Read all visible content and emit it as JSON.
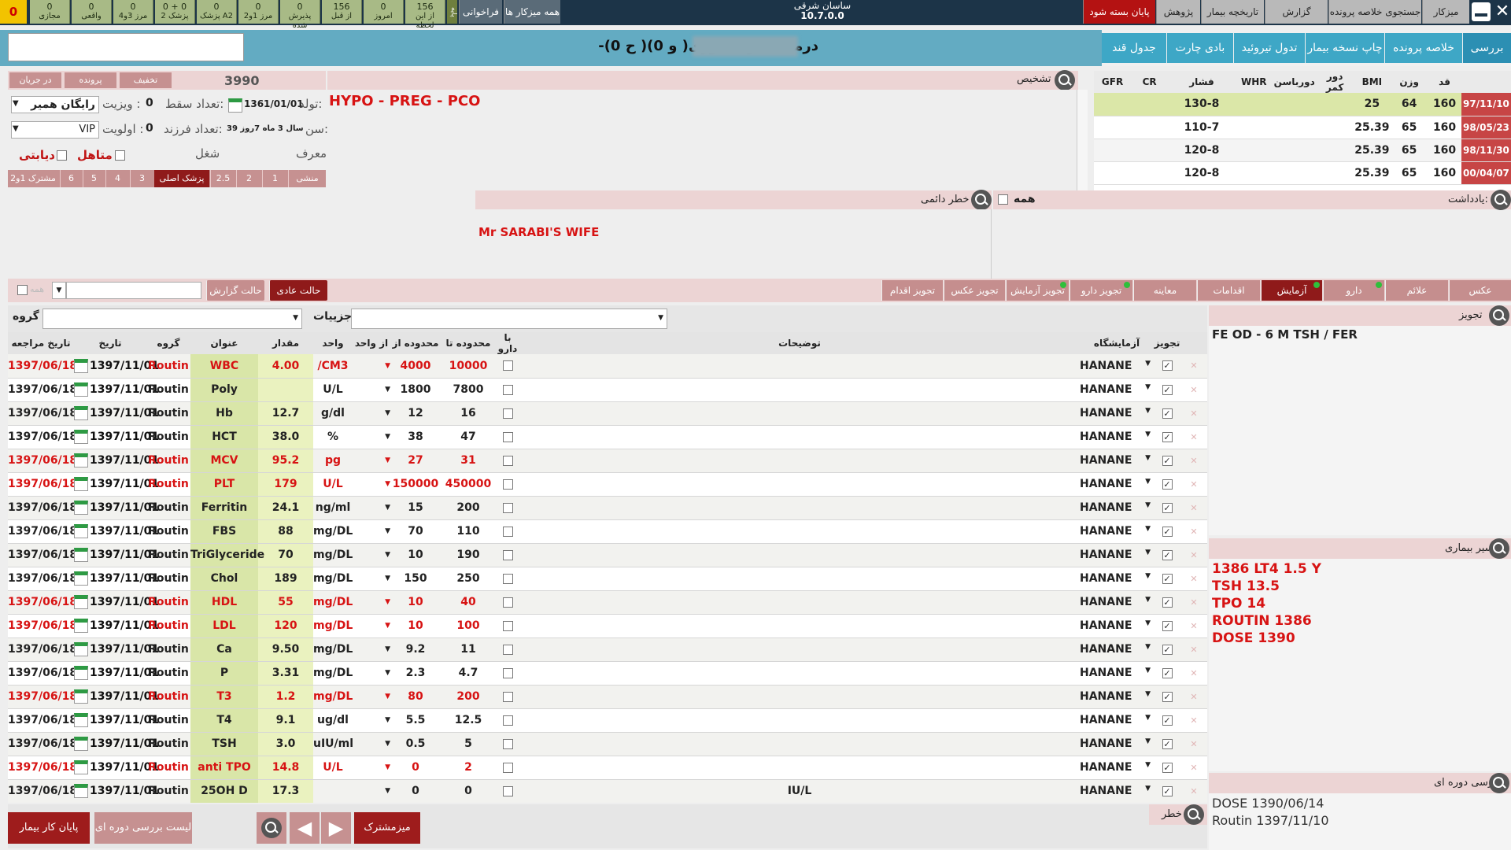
{
  "topbar": {
    "alert_count": "0",
    "stats": [
      {
        "value": "0",
        "label": "مجازی"
      },
      {
        "value": "0",
        "label": "واقعی"
      },
      {
        "value": "0",
        "label": "مرز 3و4"
      },
      {
        "value": "0 + 0",
        "label": "پزشک 2"
      },
      {
        "value": "0",
        "label": "پزشک A2"
      },
      {
        "value": "0",
        "label": "مرز 1و2"
      },
      {
        "value": "0",
        "label": "پذیرش شده"
      },
      {
        "value": "156",
        "label": "از قبل"
      },
      {
        "value": "0",
        "label": "امروز"
      },
      {
        "value": "156",
        "label": "از این لحظه"
      }
    ],
    "side_label_paye": "پایه",
    "btn_farakhani": "فراخوانی",
    "btn_all_mizkar": "همه میزکار ها",
    "center_title": "ساسان شرقی",
    "version": "10.7.0.0",
    "btn_end": "پایان بسته شود",
    "menu": [
      "پژوهش",
      "تاریخچه بیمار",
      "گزارش پرداختی",
      "جستجوی خلاصه پرونده",
      "میزکار"
    ]
  },
  "nav": {
    "patient_title": "-درمان غیر حضوری( و 0)( ح 0)",
    "tabs": [
      "جدول قند",
      "بادی چارت",
      "تدول تیروئید",
      "چاپ نسخه بیمار",
      "خلاصه پرونده",
      "بررسی"
    ]
  },
  "patient": {
    "amount": "3990",
    "btn_takhfif": "تخفیف",
    "btn_parvande": "پرونده",
    "btn_dar_jaryan": "در جریان",
    "birth_label": "تولد:",
    "birth": "1361/01/01",
    "age_label": "سن:",
    "age": "39 سال 3 ماه 7روز",
    "visit_label": "ویزیت :",
    "visit": "رایگان همیر",
    "priority_label": "اولویت :",
    "priority": "VIP",
    "abortion_label": "تعداد سقط:",
    "abortion": "0",
    "children_label": "تعداد فرزند:",
    "children": "0",
    "job_label": "شغل",
    "moaref_label": "معرف",
    "married_label": "متاهل",
    "diabetic_label": "دیابتی",
    "doc_tabs": [
      "منشی",
      "1",
      "2",
      "2.5",
      "پزشک اصلی",
      "3",
      "4",
      "5",
      "6",
      "مشترک 1و2"
    ],
    "diagnosis_label": "تشخیص",
    "diagnosis": "HYPO - PREG - PCO"
  },
  "vitals": {
    "headers": [
      "قد",
      "وزن",
      "BMI",
      "دور کمر",
      "دورباسن",
      "WHR",
      "فشار",
      "CR",
      "GFR"
    ],
    "rows": [
      {
        "date": "97/11/10",
        "height": "160",
        "weight": "64",
        "bmi": "25",
        "bp": "130-8"
      },
      {
        "date": "98/05/23",
        "height": "160",
        "weight": "65",
        "bmi": "25.39",
        "bp": "110-7"
      },
      {
        "date": "98/11/30",
        "height": "160",
        "weight": "65",
        "bmi": "25.39",
        "bp": "120-8"
      },
      {
        "date": "00/04/07",
        "height": "160",
        "weight": "65",
        "bmi": "25.39",
        "bp": "120-8"
      }
    ]
  },
  "notes": {
    "yaddasht_label": "یادداشت:",
    "all_label": "همه",
    "permanent_risk_label": "خطر دائمی",
    "permanent_risk": "Mr  SARABI'S  WIFE"
  },
  "tabs2": {
    "items": [
      "عکس",
      "علائم",
      "دارو",
      "آزمایش",
      "اقدامات",
      "معاینه",
      "تجویز دارو",
      "تجویز آزمایش",
      "تجویز عکس",
      "تجویز اقدام"
    ],
    "active": "آزمایش",
    "mode_normal": "حالت عادی",
    "mode_report": "حالت گزارش",
    "all_small": "همه"
  },
  "filters": {
    "group_label": "گروه",
    "details_label": "جزییات"
  },
  "lab": {
    "headers": [
      "تجویز",
      "آزمایشگاه",
      "توضیحات",
      "با دارو",
      "محدوده تا",
      "محدوده از",
      "از واحد",
      "واحد",
      "مقدار",
      "عنوان",
      "گروه",
      "تاریخ",
      "تاریخ مراجعه"
    ],
    "rows": [
      {
        "ref": "1397/06/18",
        "date": "1397/11/01",
        "group": "Routin",
        "title": "WBC",
        "value": "4.00",
        "unit": "/CM3",
        "from": "4000",
        "to": "10000",
        "desc": "",
        "lab": "HANANE",
        "red": true
      },
      {
        "ref": "1397/06/18",
        "date": "1397/11/01",
        "group": "Routin",
        "title": "Poly",
        "value": "",
        "unit": "U/L",
        "from": "1800",
        "to": "7800",
        "desc": "",
        "lab": "HANANE",
        "red": false
      },
      {
        "ref": "1397/06/18",
        "date": "1397/11/01",
        "group": "Routin",
        "title": "Hb",
        "value": "12.7",
        "unit": "g/dl",
        "from": "12",
        "to": "16",
        "desc": "",
        "lab": "HANANE",
        "red": false
      },
      {
        "ref": "1397/06/18",
        "date": "1397/11/01",
        "group": "Routin",
        "title": "HCT",
        "value": "38.0",
        "unit": "%",
        "from": "38",
        "to": "47",
        "desc": "",
        "lab": "HANANE",
        "red": false
      },
      {
        "ref": "1397/06/18",
        "date": "1397/11/01",
        "group": "Routin",
        "title": "MCV",
        "value": "95.2",
        "unit": "pg",
        "from": "27",
        "to": "31",
        "desc": "",
        "lab": "HANANE",
        "red": true
      },
      {
        "ref": "1397/06/18",
        "date": "1397/11/01",
        "group": "Routin",
        "title": "PLT",
        "value": "179",
        "unit": "U/L",
        "from": "150000",
        "to": "450000",
        "desc": "",
        "lab": "HANANE",
        "red": true
      },
      {
        "ref": "1397/06/18",
        "date": "1397/11/01",
        "group": "Routin",
        "title": "Ferritin",
        "value": "24.1",
        "unit": "ng/ml",
        "from": "15",
        "to": "200",
        "desc": "",
        "lab": "HANANE",
        "red": false
      },
      {
        "ref": "1397/06/18",
        "date": "1397/11/01",
        "group": "Routin",
        "title": "FBS",
        "value": "88",
        "unit": "mg/DL",
        "from": "70",
        "to": "110",
        "desc": "",
        "lab": "HANANE",
        "red": false
      },
      {
        "ref": "1397/06/18",
        "date": "1397/11/01",
        "group": "Routin",
        "title": "TriGlyceride",
        "value": "70",
        "unit": "mg/DL",
        "from": "10",
        "to": "190",
        "desc": "",
        "lab": "HANANE",
        "red": false
      },
      {
        "ref": "1397/06/18",
        "date": "1397/11/01",
        "group": "Routin",
        "title": "Chol",
        "value": "189",
        "unit": "mg/DL",
        "from": "150",
        "to": "250",
        "desc": "",
        "lab": "HANANE",
        "red": false
      },
      {
        "ref": "1397/06/18",
        "date": "1397/11/01",
        "group": "Routin",
        "title": "HDL",
        "value": "55",
        "unit": "mg/DL",
        "from": "10",
        "to": "40",
        "desc": "",
        "lab": "HANANE",
        "red": true
      },
      {
        "ref": "1397/06/18",
        "date": "1397/11/01",
        "group": "Routin",
        "title": "LDL",
        "value": "120",
        "unit": "mg/DL",
        "from": "10",
        "to": "100",
        "desc": "",
        "lab": "HANANE",
        "red": true
      },
      {
        "ref": "1397/06/18",
        "date": "1397/11/01",
        "group": "Routin",
        "title": "Ca",
        "value": "9.50",
        "unit": "mg/DL",
        "from": "9.2",
        "to": "11",
        "desc": "",
        "lab": "HANANE",
        "red": false
      },
      {
        "ref": "1397/06/18",
        "date": "1397/11/01",
        "group": "Routin",
        "title": "P",
        "value": "3.31",
        "unit": "mg/DL",
        "from": "2.3",
        "to": "4.7",
        "desc": "",
        "lab": "HANANE",
        "red": false
      },
      {
        "ref": "1397/06/18",
        "date": "1397/11/01",
        "group": "Routin",
        "title": "T3",
        "value": "1.2",
        "unit": "mg/DL",
        "from": "80",
        "to": "200",
        "desc": "",
        "lab": "HANANE",
        "red": true
      },
      {
        "ref": "1397/06/18",
        "date": "1397/11/01",
        "group": "Routin",
        "title": "T4",
        "value": "9.1",
        "unit": "ug/dl",
        "from": "5.5",
        "to": "12.5",
        "desc": "",
        "lab": "HANANE",
        "red": false
      },
      {
        "ref": "1397/06/18",
        "date": "1397/11/01",
        "group": "Routin",
        "title": "TSH",
        "value": "3.0",
        "unit": "uIU/ml",
        "from": "0.5",
        "to": "5",
        "desc": "",
        "lab": "HANANE",
        "red": false
      },
      {
        "ref": "1397/06/18",
        "date": "1397/11/01",
        "group": "Routin",
        "title": "anti TPO",
        "value": "14.8",
        "unit": "U/L",
        "from": "0",
        "to": "2",
        "desc": "",
        "lab": "HANANE",
        "red": true
      },
      {
        "ref": "1397/06/18",
        "date": "1397/11/01",
        "group": "Routin",
        "title": "25OH D",
        "value": "17.3",
        "unit": "",
        "from": "0",
        "to": "0",
        "desc": "IU/L",
        "lab": "HANANE",
        "red": false
      }
    ]
  },
  "right": {
    "tajviz_label": "تجویز",
    "tajviz_text": "FE   OD - 6 M TSH / FER",
    "history_label": "سیر بیماری",
    "history_lines": [
      "1386    LT4   1.5  Y",
      "TSH       13.5",
      "TPO         14",
      "ROUTIN   1386",
      "DOSE      1390"
    ],
    "periodic_label": "بررسی دوره ای",
    "periodic_lines": [
      "DOSE     1390/06/14",
      "Routin     1397/11/10"
    ]
  },
  "bottom": {
    "risk_label": "خطر",
    "btn_shared": "میزمشترک",
    "btn_periodic_list": "لیست بررسی دوره ای",
    "btn_end_patient": "پایان کار بیمار"
  }
}
